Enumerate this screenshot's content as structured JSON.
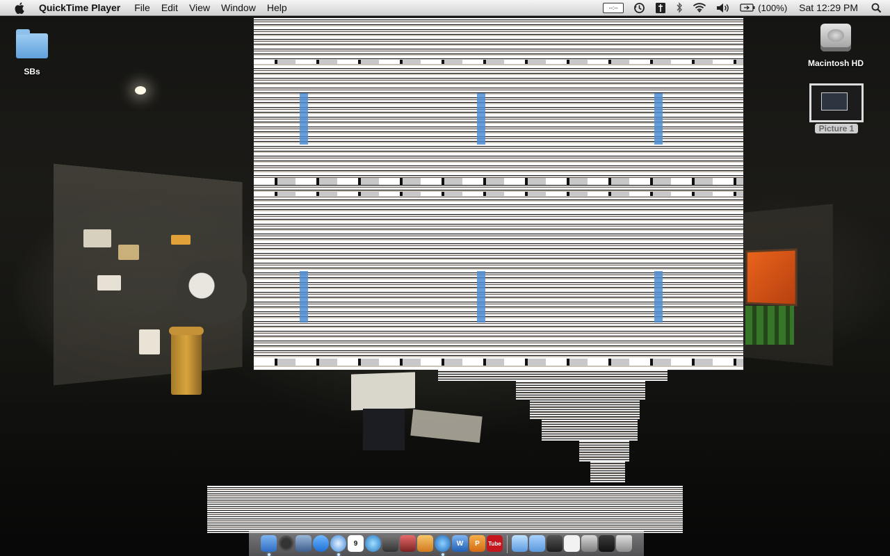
{
  "menubar": {
    "app_name": "QuickTime Player",
    "menus": [
      "File",
      "Edit",
      "View",
      "Window",
      "Help"
    ],
    "battery_text": "(100%)",
    "clock": "Sat 12:29 PM"
  },
  "desktop": {
    "folder_label": "SBs",
    "drive_label": "Macintosh HD",
    "screenshot_label": "Picture 1"
  },
  "dock": {
    "apps": [
      "finder",
      "dashboard",
      "mail",
      "ichat",
      "safari",
      "ical",
      "itunes",
      "photo-booth",
      "iphoto",
      "quicktime",
      "word",
      "powerpoint",
      "youtube"
    ],
    "ical_day": "9",
    "youtube_label": "Tube"
  },
  "colors": {
    "menubar_top": "#f4f4f4",
    "menubar_bottom": "#d2d2d2",
    "folder_blue": "#5fa0dc",
    "billboard_orange": "#e9641c"
  }
}
